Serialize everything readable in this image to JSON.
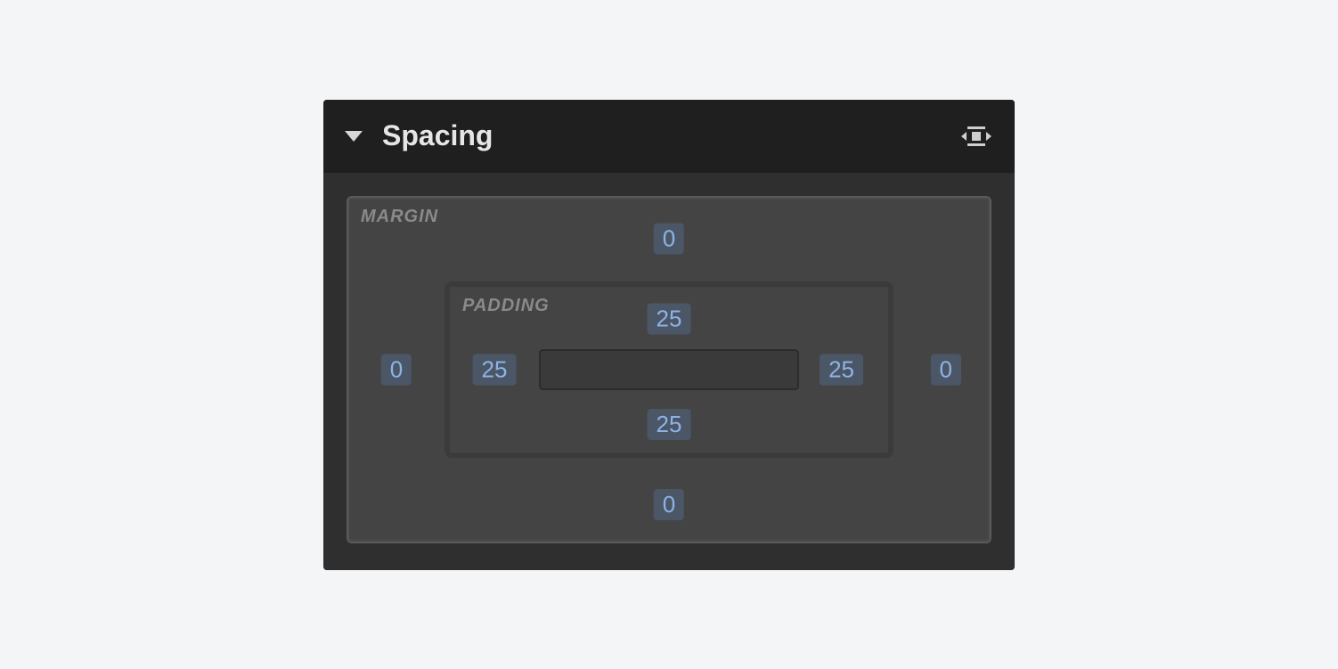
{
  "header": {
    "title": "Spacing"
  },
  "labels": {
    "margin": "MARGIN",
    "padding": "PADDING"
  },
  "margin": {
    "top": "0",
    "right": "0",
    "bottom": "0",
    "left": "0"
  },
  "padding": {
    "top": "25",
    "right": "25",
    "bottom": "25",
    "left": "25"
  }
}
